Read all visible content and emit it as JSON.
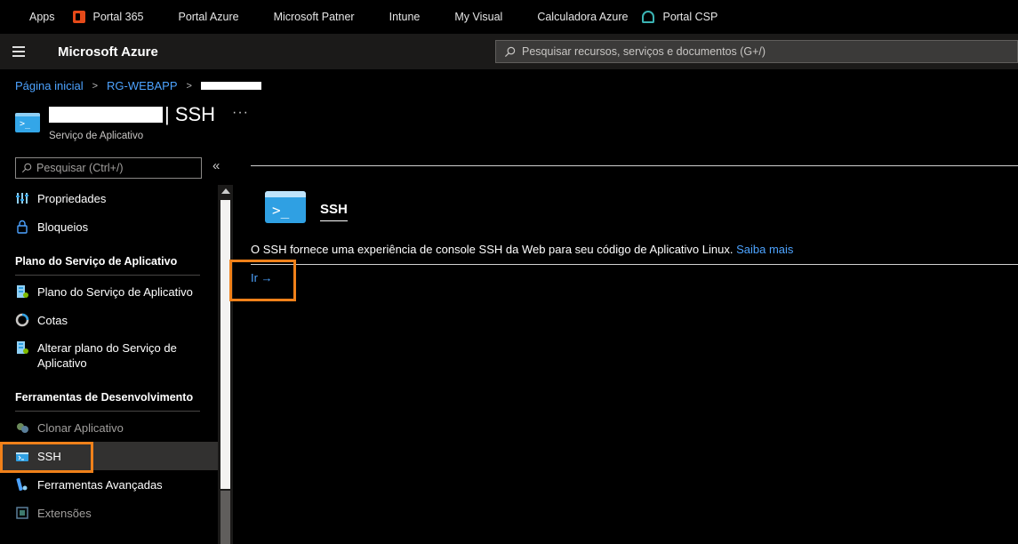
{
  "bookmarks": [
    {
      "label": "Apps",
      "icon": "apps-grid-icon"
    },
    {
      "label": "Portal 365",
      "icon": "office-365-icon"
    },
    {
      "label": "Portal Azure",
      "icon": "microsoft-logo-icon"
    },
    {
      "label": "Microsoft Patner",
      "icon": "microsoft-logo-icon"
    },
    {
      "label": "Intune",
      "icon": "microsoft-logo-icon"
    },
    {
      "label": "My Visual",
      "icon": "microsoft-logo-icon"
    },
    {
      "label": "Calculadora Azure",
      "icon": "microsoft-logo-icon"
    },
    {
      "label": "Portal CSP",
      "icon": "csp-icon"
    }
  ],
  "header": {
    "brand": "Microsoft Azure",
    "search_placeholder": "Pesquisar recursos, serviços e documentos (G+/)"
  },
  "breadcrumb": {
    "home": "Página inicial",
    "resource_group": "RG-WEBAPP"
  },
  "page": {
    "title_suffix": "| SSH",
    "subtitle": "Serviço de Aplicativo",
    "more": "···"
  },
  "sidebar": {
    "search_placeholder": "Pesquisar (Ctrl+/)",
    "collapse": "«",
    "items_top": [
      {
        "label": "Propriedades",
        "icon": "properties-icon"
      },
      {
        "label": "Bloqueios",
        "icon": "lock-icon"
      }
    ],
    "section_plan": "Plano do Serviço de Aplicativo",
    "items_plan": [
      {
        "label": "Plano do Serviço de Aplicativo",
        "icon": "app-service-plan-icon"
      },
      {
        "label": "Cotas",
        "icon": "quota-icon"
      },
      {
        "label": "Alterar plano do Serviço de",
        "label2": "Aplicativo",
        "icon": "change-plan-icon"
      }
    ],
    "section_dev": "Ferramentas de Desenvolvimento",
    "items_dev": [
      {
        "label": "Clonar Aplicativo",
        "icon": "clone-icon"
      },
      {
        "label": "SSH",
        "icon": "ssh-icon"
      },
      {
        "label": "Ferramentas Avançadas",
        "icon": "advanced-tools-icon"
      },
      {
        "label": "Extensões",
        "icon": "extensions-icon"
      }
    ]
  },
  "main": {
    "card_title": "SSH",
    "description": "O SSH fornece uma experiência de console SSH da Web para seu código de Aplicativo Linux.",
    "learn_more": "Saiba mais",
    "go_label": "Ir →"
  },
  "colors": {
    "accent_link": "#4da3ff",
    "highlight": "#f0811a",
    "ssh_icon": "#2fa0e3"
  }
}
